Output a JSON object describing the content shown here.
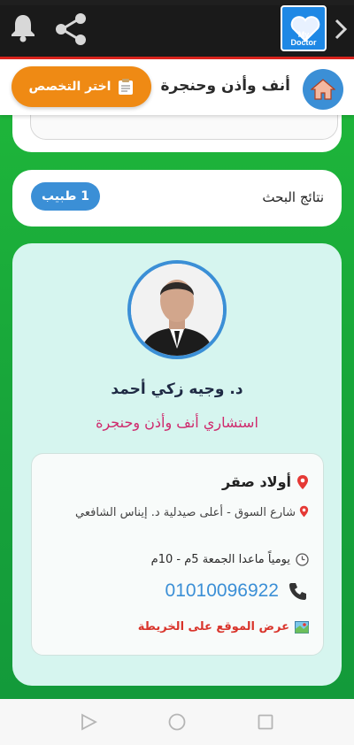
{
  "app": {
    "logo_line1": "My",
    "logo_line2": "Doctor"
  },
  "header": {
    "specialty_title": "أنف وأذن وحنجرة",
    "choose_specialty_label": "اختر التخصص"
  },
  "results": {
    "label": "نتائج البحث",
    "count_badge": "1 طبيب"
  },
  "doctor": {
    "name": "د. وجيه زكي أحمد",
    "title": "استشاري أنف وأذن وحنجرة",
    "clinic": {
      "name": "أولاد صقر",
      "address": "شارع السوق - أعلى صيدلية د. إيناس الشافعي",
      "hours": "يومياً ماعدا الجمعة 5م - 10م",
      "phone": "01010096922",
      "map_link": "عرض الموقع على الخريطة"
    }
  },
  "colors": {
    "accent_blue": "#3b8fd6",
    "orange": "#ef8a14",
    "green_bg": "#17a33a",
    "title_pink": "#cf2a6d",
    "map_red": "#d9342b"
  },
  "icons": [
    "bell-icon",
    "share-icon",
    "app-logo",
    "chevron-right-icon",
    "home-icon",
    "clipboard-icon",
    "pin-icon",
    "clock-icon",
    "phone-icon",
    "map-icon",
    "back-nav-icon",
    "home-nav-icon",
    "recents-nav-icon"
  ]
}
